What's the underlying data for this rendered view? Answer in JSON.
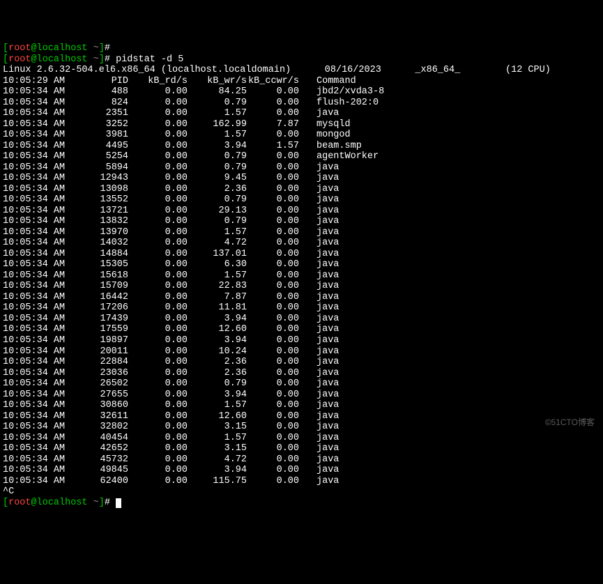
{
  "prompt0": {
    "user": "root",
    "host": "localhost",
    "cwd": "~",
    "symbol": "#"
  },
  "prompt1": {
    "user": "root",
    "host": "localhost",
    "cwd": "~",
    "symbol": "#",
    "command": "pidstat -d 5"
  },
  "sysinfo": {
    "kernel": "Linux 2.6.32-504.el6.x86_64 (localhost.localdomain)",
    "date": "08/16/2023",
    "arch": "_x86_64_",
    "cpus": "(12 CPU)"
  },
  "headers": {
    "time": "10:05:29 AM",
    "pid": "PID",
    "rd": "kB_rd/s",
    "wr": "kB_wr/s",
    "ccwr": "kB_ccwr/s",
    "cmd": "Command"
  },
  "rows": [
    {
      "time": "10:05:34 AM",
      "pid": "488",
      "rd": "0.00",
      "wr": "84.25",
      "ccwr": "0.00",
      "cmd": "jbd2/xvda3-8"
    },
    {
      "time": "10:05:34 AM",
      "pid": "824",
      "rd": "0.00",
      "wr": "0.79",
      "ccwr": "0.00",
      "cmd": "flush-202:0"
    },
    {
      "time": "10:05:34 AM",
      "pid": "2351",
      "rd": "0.00",
      "wr": "1.57",
      "ccwr": "0.00",
      "cmd": "java"
    },
    {
      "time": "10:05:34 AM",
      "pid": "3252",
      "rd": "0.00",
      "wr": "162.99",
      "ccwr": "7.87",
      "cmd": "mysqld"
    },
    {
      "time": "10:05:34 AM",
      "pid": "3981",
      "rd": "0.00",
      "wr": "1.57",
      "ccwr": "0.00",
      "cmd": "mongod"
    },
    {
      "time": "10:05:34 AM",
      "pid": "4495",
      "rd": "0.00",
      "wr": "3.94",
      "ccwr": "1.57",
      "cmd": "beam.smp"
    },
    {
      "time": "10:05:34 AM",
      "pid": "5254",
      "rd": "0.00",
      "wr": "0.79",
      "ccwr": "0.00",
      "cmd": "agentWorker"
    },
    {
      "time": "10:05:34 AM",
      "pid": "5894",
      "rd": "0.00",
      "wr": "0.79",
      "ccwr": "0.00",
      "cmd": "java"
    },
    {
      "time": "10:05:34 AM",
      "pid": "12943",
      "rd": "0.00",
      "wr": "9.45",
      "ccwr": "0.00",
      "cmd": "java"
    },
    {
      "time": "10:05:34 AM",
      "pid": "13098",
      "rd": "0.00",
      "wr": "2.36",
      "ccwr": "0.00",
      "cmd": "java"
    },
    {
      "time": "10:05:34 AM",
      "pid": "13552",
      "rd": "0.00",
      "wr": "0.79",
      "ccwr": "0.00",
      "cmd": "java"
    },
    {
      "time": "10:05:34 AM",
      "pid": "13721",
      "rd": "0.00",
      "wr": "29.13",
      "ccwr": "0.00",
      "cmd": "java"
    },
    {
      "time": "10:05:34 AM",
      "pid": "13832",
      "rd": "0.00",
      "wr": "0.79",
      "ccwr": "0.00",
      "cmd": "java"
    },
    {
      "time": "10:05:34 AM",
      "pid": "13970",
      "rd": "0.00",
      "wr": "1.57",
      "ccwr": "0.00",
      "cmd": "java"
    },
    {
      "time": "10:05:34 AM",
      "pid": "14032",
      "rd": "0.00",
      "wr": "4.72",
      "ccwr": "0.00",
      "cmd": "java"
    },
    {
      "time": "10:05:34 AM",
      "pid": "14884",
      "rd": "0.00",
      "wr": "137.01",
      "ccwr": "0.00",
      "cmd": "java"
    },
    {
      "time": "10:05:34 AM",
      "pid": "15305",
      "rd": "0.00",
      "wr": "6.30",
      "ccwr": "0.00",
      "cmd": "java"
    },
    {
      "time": "10:05:34 AM",
      "pid": "15618",
      "rd": "0.00",
      "wr": "1.57",
      "ccwr": "0.00",
      "cmd": "java"
    },
    {
      "time": "10:05:34 AM",
      "pid": "15709",
      "rd": "0.00",
      "wr": "22.83",
      "ccwr": "0.00",
      "cmd": "java"
    },
    {
      "time": "10:05:34 AM",
      "pid": "16442",
      "rd": "0.00",
      "wr": "7.87",
      "ccwr": "0.00",
      "cmd": "java"
    },
    {
      "time": "10:05:34 AM",
      "pid": "17206",
      "rd": "0.00",
      "wr": "11.81",
      "ccwr": "0.00",
      "cmd": "java"
    },
    {
      "time": "10:05:34 AM",
      "pid": "17439",
      "rd": "0.00",
      "wr": "3.94",
      "ccwr": "0.00",
      "cmd": "java"
    },
    {
      "time": "10:05:34 AM",
      "pid": "17559",
      "rd": "0.00",
      "wr": "12.60",
      "ccwr": "0.00",
      "cmd": "java"
    },
    {
      "time": "10:05:34 AM",
      "pid": "19897",
      "rd": "0.00",
      "wr": "3.94",
      "ccwr": "0.00",
      "cmd": "java"
    },
    {
      "time": "10:05:34 AM",
      "pid": "20011",
      "rd": "0.00",
      "wr": "10.24",
      "ccwr": "0.00",
      "cmd": "java"
    },
    {
      "time": "10:05:34 AM",
      "pid": "22884",
      "rd": "0.00",
      "wr": "2.36",
      "ccwr": "0.00",
      "cmd": "java"
    },
    {
      "time": "10:05:34 AM",
      "pid": "23036",
      "rd": "0.00",
      "wr": "2.36",
      "ccwr": "0.00",
      "cmd": "java"
    },
    {
      "time": "10:05:34 AM",
      "pid": "26502",
      "rd": "0.00",
      "wr": "0.79",
      "ccwr": "0.00",
      "cmd": "java"
    },
    {
      "time": "10:05:34 AM",
      "pid": "27655",
      "rd": "0.00",
      "wr": "3.94",
      "ccwr": "0.00",
      "cmd": "java"
    },
    {
      "time": "10:05:34 AM",
      "pid": "30860",
      "rd": "0.00",
      "wr": "1.57",
      "ccwr": "0.00",
      "cmd": "java"
    },
    {
      "time": "10:05:34 AM",
      "pid": "32611",
      "rd": "0.00",
      "wr": "12.60",
      "ccwr": "0.00",
      "cmd": "java"
    },
    {
      "time": "10:05:34 AM",
      "pid": "32802",
      "rd": "0.00",
      "wr": "3.15",
      "ccwr": "0.00",
      "cmd": "java"
    },
    {
      "time": "10:05:34 AM",
      "pid": "40454",
      "rd": "0.00",
      "wr": "1.57",
      "ccwr": "0.00",
      "cmd": "java"
    },
    {
      "time": "10:05:34 AM",
      "pid": "42652",
      "rd": "0.00",
      "wr": "3.15",
      "ccwr": "0.00",
      "cmd": "java"
    },
    {
      "time": "10:05:34 AM",
      "pid": "45732",
      "rd": "0.00",
      "wr": "4.72",
      "ccwr": "0.00",
      "cmd": "java"
    },
    {
      "time": "10:05:34 AM",
      "pid": "49845",
      "rd": "0.00",
      "wr": "3.94",
      "ccwr": "0.00",
      "cmd": "java"
    },
    {
      "time": "10:05:34 AM",
      "pid": "62400",
      "rd": "0.00",
      "wr": "115.75",
      "ccwr": "0.00",
      "cmd": "java"
    }
  ],
  "interrupt": "^C",
  "prompt2": {
    "user": "root",
    "host": "localhost",
    "cwd": "~",
    "symbol": "#"
  },
  "watermark": "©51CTO博客"
}
